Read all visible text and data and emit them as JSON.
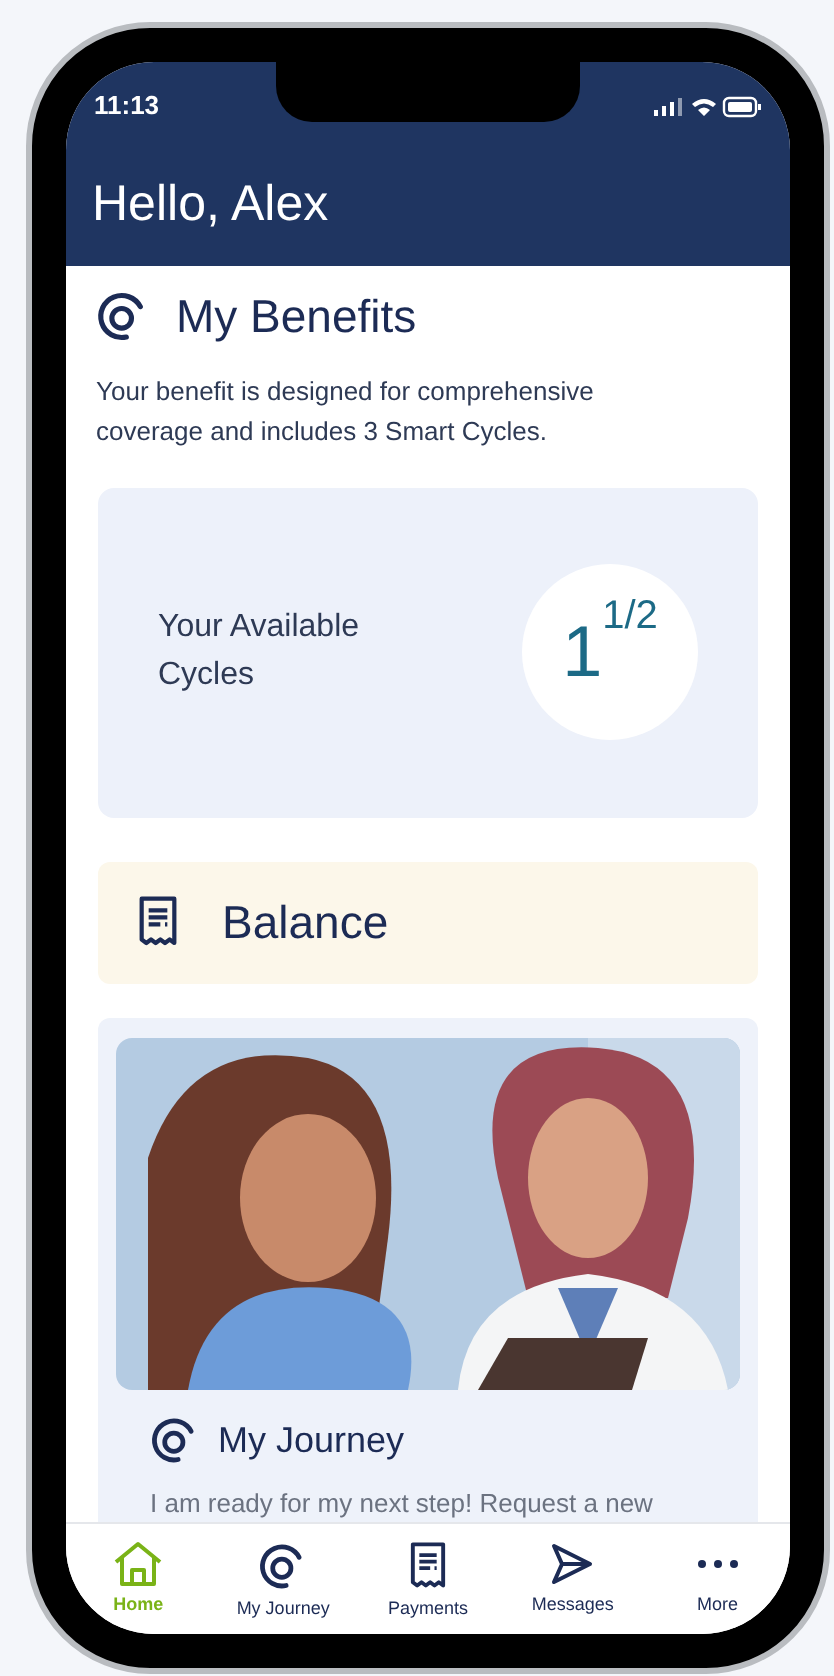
{
  "status_bar": {
    "time": "11:13"
  },
  "header": {
    "title": "Hello, Alex"
  },
  "benefits": {
    "title": "My Benefits",
    "description": "Your benefit is designed for comprehensive coverage and includes 3 Smart Cycles.",
    "cycles_label": "Your Available Cycles",
    "cycles_value": "1$^{1/2}$"
  },
  "balance": {
    "title": "Balance"
  },
  "journey": {
    "title": "My Journey",
    "text": "I am ready for my next step! Request a new"
  },
  "tab_bar": [
    {
      "kind": "home",
      "label": "Home",
      "selected": true
    },
    {
      "kind": "journey",
      "label": "My Journey",
      "selected": false
    },
    {
      "kind": "payments",
      "label": "Payments",
      "selected": false
    },
    {
      "kind": "messages",
      "label": "Messages",
      "selected": false
    },
    {
      "kind": "more",
      "label": "More",
      "selected": false
    }
  ]
}
